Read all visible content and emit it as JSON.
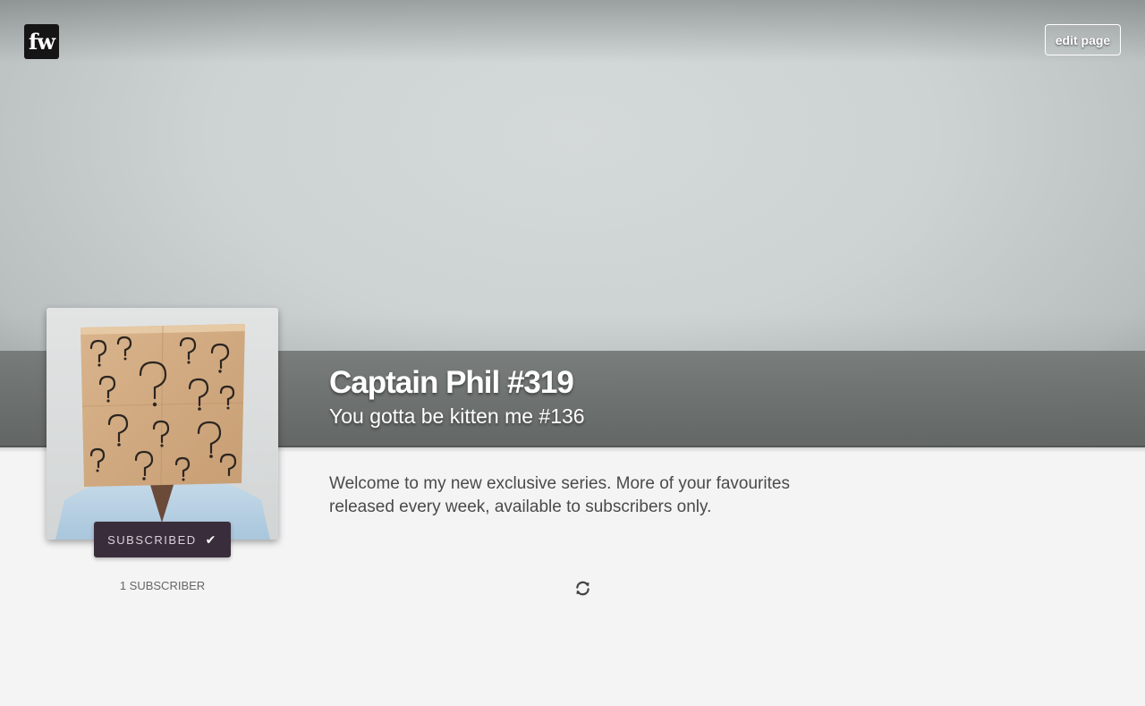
{
  "logo": {
    "text": "fw",
    "icon": "fw-logo-icon"
  },
  "header": {
    "edit_label": "edit page"
  },
  "series": {
    "title": "Captain Phil #319",
    "subtitle": "You gotta be kitten me #136",
    "description": "Welcome to my new exclusive series. More of your favourites released every week, available to subscribers only."
  },
  "subscription": {
    "button_label": "SUBSCRIBED",
    "button_icon": "checkmark-icon",
    "count_label": "1 SUBSCRIBER"
  },
  "loader": {
    "icon": "refresh-icon"
  },
  "colors": {
    "subscribe_button": "#3a2d3b",
    "page_background": "#f4f4f4",
    "logo_background": "#151515"
  }
}
